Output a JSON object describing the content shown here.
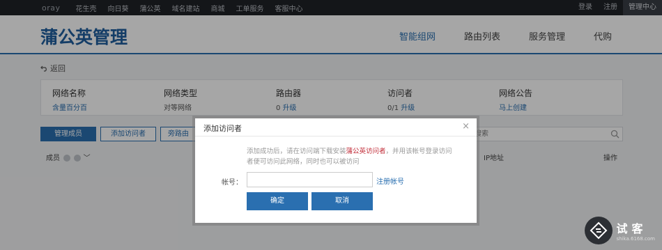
{
  "topbar": {
    "brand": "oray",
    "nav": [
      "花生壳",
      "向日葵",
      "蒲公英",
      "域名建站",
      "商城",
      "工单服务",
      "客服中心"
    ],
    "right": [
      "登录",
      "注册",
      "管理中心"
    ]
  },
  "header": {
    "title": "蒲公英管理",
    "nav": [
      "智能组网",
      "路由列表",
      "服务管理",
      "代购"
    ]
  },
  "back_label": "返回",
  "info": {
    "network_name_label": "网络名称",
    "network_name_value": "含量百分百",
    "network_type_label": "网络类型",
    "network_type_value": "对等网络",
    "router_label": "路由器",
    "router_count": "0",
    "router_upgrade": "升级",
    "visitor_label": "访问者",
    "visitor_count": "0/1",
    "visitor_upgrade": "升级",
    "announce_label": "网络公告",
    "announce_value": "马上创建"
  },
  "tabs": [
    "管理成员",
    "添加访问者",
    "旁路由"
  ],
  "search_placeholder": "搜索",
  "table_header": {
    "member": "成员",
    "ip": "IP地址",
    "action": "操作"
  },
  "dialog": {
    "title": "添加访问者",
    "close": "×",
    "desc_before": "添加成功后，请在访问端下载安装",
    "desc_highlight": "蒲公英访问者",
    "desc_after": "，并用该帐号登录访问者便可访问此网络，同时也可以被访问",
    "account_label": "帐号：",
    "account_value": "",
    "register_link": "注册帐号",
    "ok_label": "确定",
    "cancel_label": "取消"
  },
  "watermark": {
    "title": "试客",
    "domain": "shika.6168.com"
  },
  "colors": {
    "accent": "#2a6fb0",
    "highlight": "#c22e3a",
    "topbar": "#1f2227"
  }
}
